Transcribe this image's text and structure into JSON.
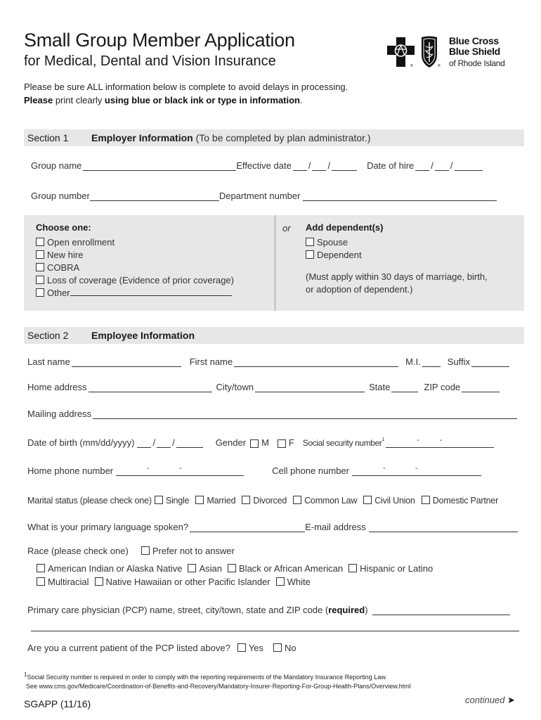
{
  "header": {
    "title": "Small Group Member Application",
    "subtitle": "for Medical, Dental and Vision Insurance",
    "intro_line1": "Please be sure ALL information below is complete to avoid delays in processing.",
    "intro_line2_bold1": "Please",
    "intro_line2_normal": " print clearly ",
    "intro_line2_bold2": "using blue or black ink or type in information",
    "intro_line2_end": "."
  },
  "logo": {
    "line1": "Blue Cross",
    "line2": "Blue Shield",
    "line3": "of Rhode Island",
    "icons": [
      "cross-icon",
      "shield-icon"
    ]
  },
  "section1": {
    "number": "Section 1",
    "title": "Employer Information",
    "note": " (To be completed by plan administrator.)",
    "fields": {
      "group_name": "Group name",
      "effective_date": "Effective date",
      "date_of_hire": "Date of hire",
      "group_number": "Group number",
      "department_number": "Department  number"
    },
    "choose_one": {
      "header": "Choose one:",
      "options": [
        "Open enrollment",
        "New hire",
        "COBRA",
        "Loss of coverage (Evidence of prior coverage)",
        "Other"
      ]
    },
    "or_label": "or",
    "add_dependents": {
      "header": "Add dependent(s)",
      "options": [
        "Spouse",
        "Dependent"
      ],
      "note_line1": "(Must apply within 30 days of marriage, birth,",
      "note_line2": "or adoption of dependent.)"
    }
  },
  "section2": {
    "number": "Section 2",
    "title": "Employee Information",
    "fields": {
      "last_name": "Last name",
      "first_name": "First name",
      "mi": "M.I.",
      "suffix": "Suffix",
      "home_address": "Home address",
      "city_town": "City/town",
      "state": "State",
      "zip": "ZIP code",
      "mailing_address": "Mailing address",
      "dob": "Date of birth (mm/dd/yyyy)",
      "gender": "Gender",
      "gender_m": "M",
      "gender_f": "F",
      "ssn": "Social security number",
      "ssn_sup": "1",
      "home_phone": "Home phone number",
      "cell_phone": "Cell phone number",
      "marital_status": "Marital status (please check one)",
      "language": "What is your primary language spoken?",
      "email": "E-mail address",
      "race": "Race (please check one)",
      "race_prefer_not": "Prefer not to answer",
      "pcp_label": "Primary care physician (PCP) name, street, city/town, state and ZIP code (",
      "pcp_required": "required",
      "pcp_end": ")",
      "current_patient": "Are you a current patient of the PCP listed above?",
      "yes": "Yes",
      "no": "No"
    },
    "marital_options": [
      "Single",
      "Married",
      "Divorced",
      "Common Law",
      "Civil Union",
      "Domestic Partner"
    ],
    "race_row1": [
      "American Indian or Alaska Native",
      "Asian",
      "Black or African American",
      "Hispanic or Latino"
    ],
    "race_row2": [
      "Multiracial",
      "Native Hawaiian or other Pacific Islander",
      "White"
    ]
  },
  "footer": {
    "footnote_mark": "1",
    "footnote_line1": "Social Security number is required in order to comply with the reporting requirements of the Mandatory Insurance Reporting Law.",
    "footnote_line2": "See www.cms.gov/Medicare/Coordination-of-Benefits-and-Recovery/Mandatory-Insurer-Reporting-For-Group-Health-Plans/Overview.html",
    "form_number": "SGAPP (11/16)",
    "continued": "continued",
    "continued_icon": "arrow-right-icon"
  }
}
